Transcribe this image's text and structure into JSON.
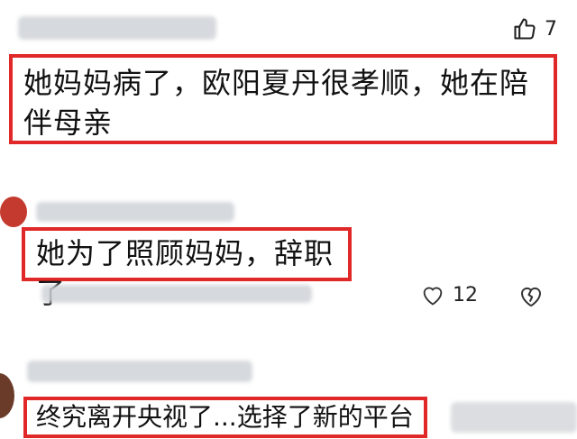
{
  "comments": [
    {
      "text": "她妈妈病了，欧阳夏丹很孝顺，她在陪伴母亲",
      "likes": "7"
    },
    {
      "text": "她为了照顾妈妈，辞职了",
      "likes": "12"
    },
    {
      "text": "终究离开央视了...选择了新的平台"
    }
  ],
  "colors": {
    "highlight": "#e02828"
  },
  "icons": {
    "like": "thumbs-up-icon",
    "dislike": "broken-heart-icon",
    "heart": "heart-outline-icon"
  }
}
